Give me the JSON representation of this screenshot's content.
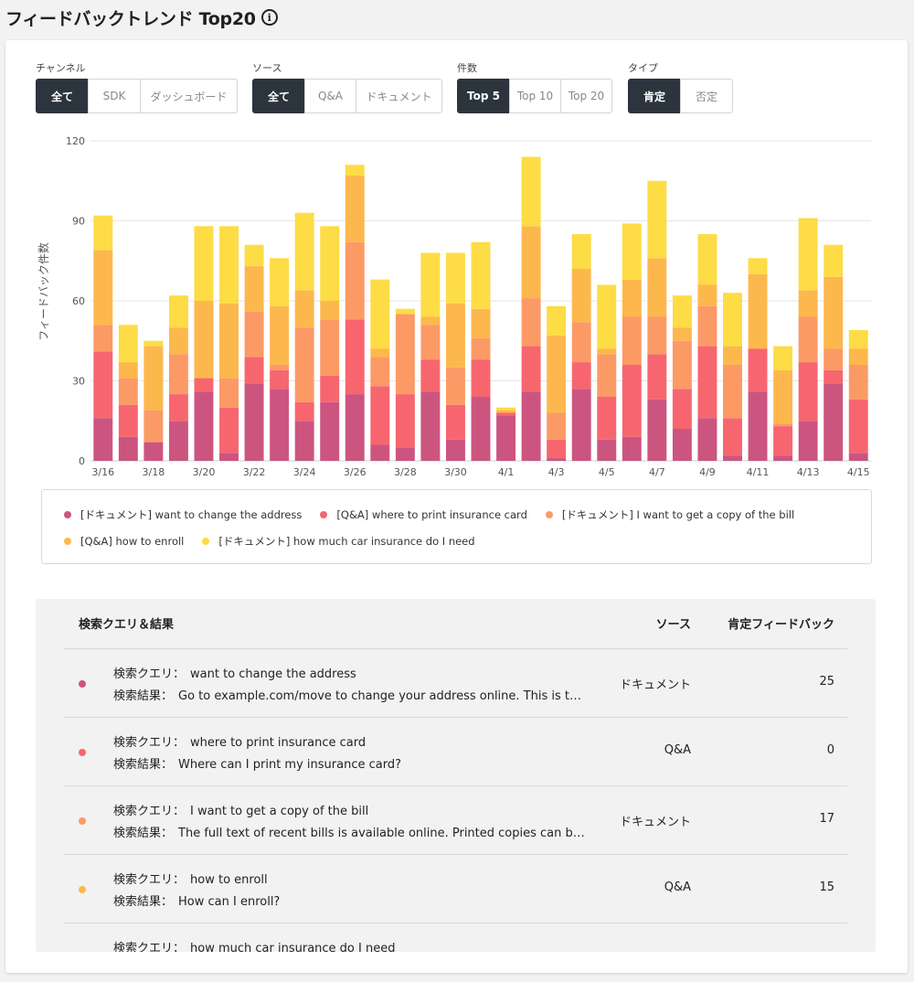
{
  "page": {
    "title": "フィードバックトレンド Top20",
    "info_icon": "info-icon"
  },
  "filters": [
    {
      "label": "チャンネル",
      "options": [
        "全て",
        "SDK",
        "ダッシュボード"
      ],
      "active": 0
    },
    {
      "label": "ソース",
      "options": [
        "全て",
        "Q&A",
        "ドキュメント"
      ],
      "active": 0
    },
    {
      "label": "件数",
      "options": [
        "Top 5",
        "Top 10",
        "Top 20"
      ],
      "active": 0
    },
    {
      "label": "タイプ",
      "options": [
        "肯定",
        "否定"
      ],
      "active": 0
    }
  ],
  "chart_data": {
    "type": "bar",
    "stacked": true,
    "ylabel": "フィードバック件数",
    "ylim": [
      0,
      120
    ],
    "yticks": [
      0,
      30,
      60,
      90,
      120
    ],
    "grid": true,
    "legend_position": "bottom",
    "categories": [
      "3/16",
      "3/17",
      "3/18",
      "3/19",
      "3/20",
      "3/21",
      "3/22",
      "3/23",
      "3/24",
      "3/25",
      "3/26",
      "3/27",
      "3/28",
      "3/29",
      "3/30",
      "3/31",
      "4/1",
      "4/2",
      "4/3",
      "4/4",
      "4/5",
      "4/6",
      "4/7",
      "4/8",
      "4/9",
      "4/10",
      "4/11",
      "4/12",
      "4/13",
      "4/14",
      "4/15"
    ],
    "xtick_labels": [
      "3/16",
      "3/18",
      "3/20",
      "3/22",
      "3/24",
      "3/26",
      "3/28",
      "3/30",
      "4/1",
      "4/3",
      "4/5",
      "4/7",
      "4/9",
      "4/11",
      "4/13",
      "4/15"
    ],
    "series": [
      {
        "name": "[ドキュメント] want to change the address",
        "color": "#cc5580",
        "values": [
          16,
          9,
          7,
          15,
          26,
          3,
          29,
          27,
          15,
          22,
          25,
          6,
          5,
          26,
          8,
          24,
          17,
          26,
          1,
          27,
          8,
          9,
          23,
          12,
          16,
          2,
          26,
          2,
          15,
          29,
          3
        ]
      },
      {
        "name": "[Q&A] where to print insurance card",
        "color": "#f7666f",
        "values": [
          25,
          12,
          0,
          10,
          5,
          17,
          10,
          7,
          7,
          10,
          28,
          22,
          20,
          12,
          13,
          14,
          1,
          17,
          7,
          10,
          16,
          27,
          17,
          15,
          27,
          14,
          16,
          11,
          22,
          5,
          20
        ]
      },
      {
        "name": "[ドキュメント] I want to get a copy of the bill",
        "color": "#fc9a66",
        "values": [
          10,
          10,
          12,
          15,
          0,
          11,
          17,
          2,
          28,
          21,
          29,
          11,
          30,
          13,
          14,
          8,
          0,
          18,
          10,
          15,
          16,
          18,
          14,
          18,
          15,
          20,
          0,
          1,
          17,
          8,
          13
        ]
      },
      {
        "name": "[Q&A] how to enroll",
        "color": "#fdb84d",
        "values": [
          28,
          6,
          24,
          10,
          29,
          28,
          17,
          22,
          14,
          7,
          25,
          3,
          0,
          3,
          24,
          11,
          1,
          27,
          29,
          20,
          2,
          14,
          22,
          5,
          8,
          7,
          28,
          20,
          10,
          27,
          6
        ]
      },
      {
        "name": "[ドキュメント] how much car insurance do I need",
        "color": "#fddc45",
        "values": [
          13,
          14,
          2,
          12,
          28,
          29,
          8,
          18,
          29,
          28,
          4,
          26,
          2,
          24,
          19,
          25,
          1,
          26,
          11,
          13,
          24,
          21,
          29,
          12,
          19,
          20,
          6,
          9,
          27,
          12,
          7
        ]
      }
    ]
  },
  "table": {
    "headers": {
      "query": "検索クエリ＆結果",
      "source": "ソース",
      "positive": "肯定フィードバック"
    },
    "query_prefix": "検索クエリ：",
    "result_prefix": "検索結果：",
    "rows": [
      {
        "color": "#cc5580",
        "query": "want to change the address",
        "result": "Go to example.com/move to change your address online. This is the fastest way to update",
        "source": "ドキュメント",
        "positive": "25"
      },
      {
        "color": "#f7666f",
        "query": "where to print insurance card",
        "result": "Where can I print my insurance card?",
        "source": "Q&A",
        "positive": "0"
      },
      {
        "color": "#fc9a66",
        "query": "I want to get a copy of the bill",
        "result": "The full text of recent bills is available online. Printed copies can be ordered",
        "source": "ドキュメント",
        "positive": "17"
      },
      {
        "color": "#fdb84d",
        "query": "how to enroll",
        "result": "How can I enroll?",
        "source": "Q&A",
        "positive": "15"
      },
      {
        "color": "#fddc45",
        "query": "how much car insurance do I need",
        "result": "",
        "source": "",
        "positive": ""
      }
    ]
  }
}
